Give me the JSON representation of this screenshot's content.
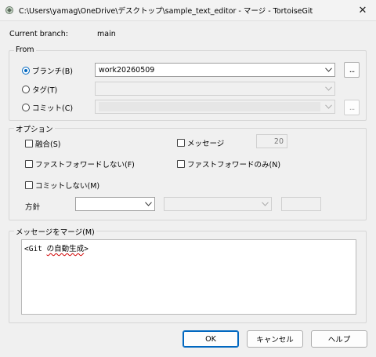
{
  "window": {
    "title": "C:\\Users\\yamag\\OneDrive\\デスクトップ\\sample_text_editor - マージ - TortoiseGit"
  },
  "branch": {
    "label": "Current branch:",
    "value": "main"
  },
  "from": {
    "legend": "From",
    "branch_label": "ブランチ(B)",
    "branch_value": "work20260509",
    "tag_label": "タグ(T)",
    "commit_label": "コミット(C)",
    "ellipsis": "..."
  },
  "options": {
    "legend": "オプション",
    "squash_label": "融合(S)",
    "message_label": "メッセージ",
    "message_count": "20",
    "no_ff_label": "ファストフォワードしない(F)",
    "ff_only_label": "ファストフォワードのみ(N)",
    "no_commit_label": "コミットしない(M)",
    "strategy_label": "方針"
  },
  "merge_message": {
    "legend": "メッセージをマージ(M)",
    "text_prefix": "<Git ",
    "text_underlined": "の自動生成",
    "text_suffix": ">"
  },
  "buttons": {
    "ok": "OK",
    "cancel": "キャンセル",
    "help": "ヘルプ"
  }
}
